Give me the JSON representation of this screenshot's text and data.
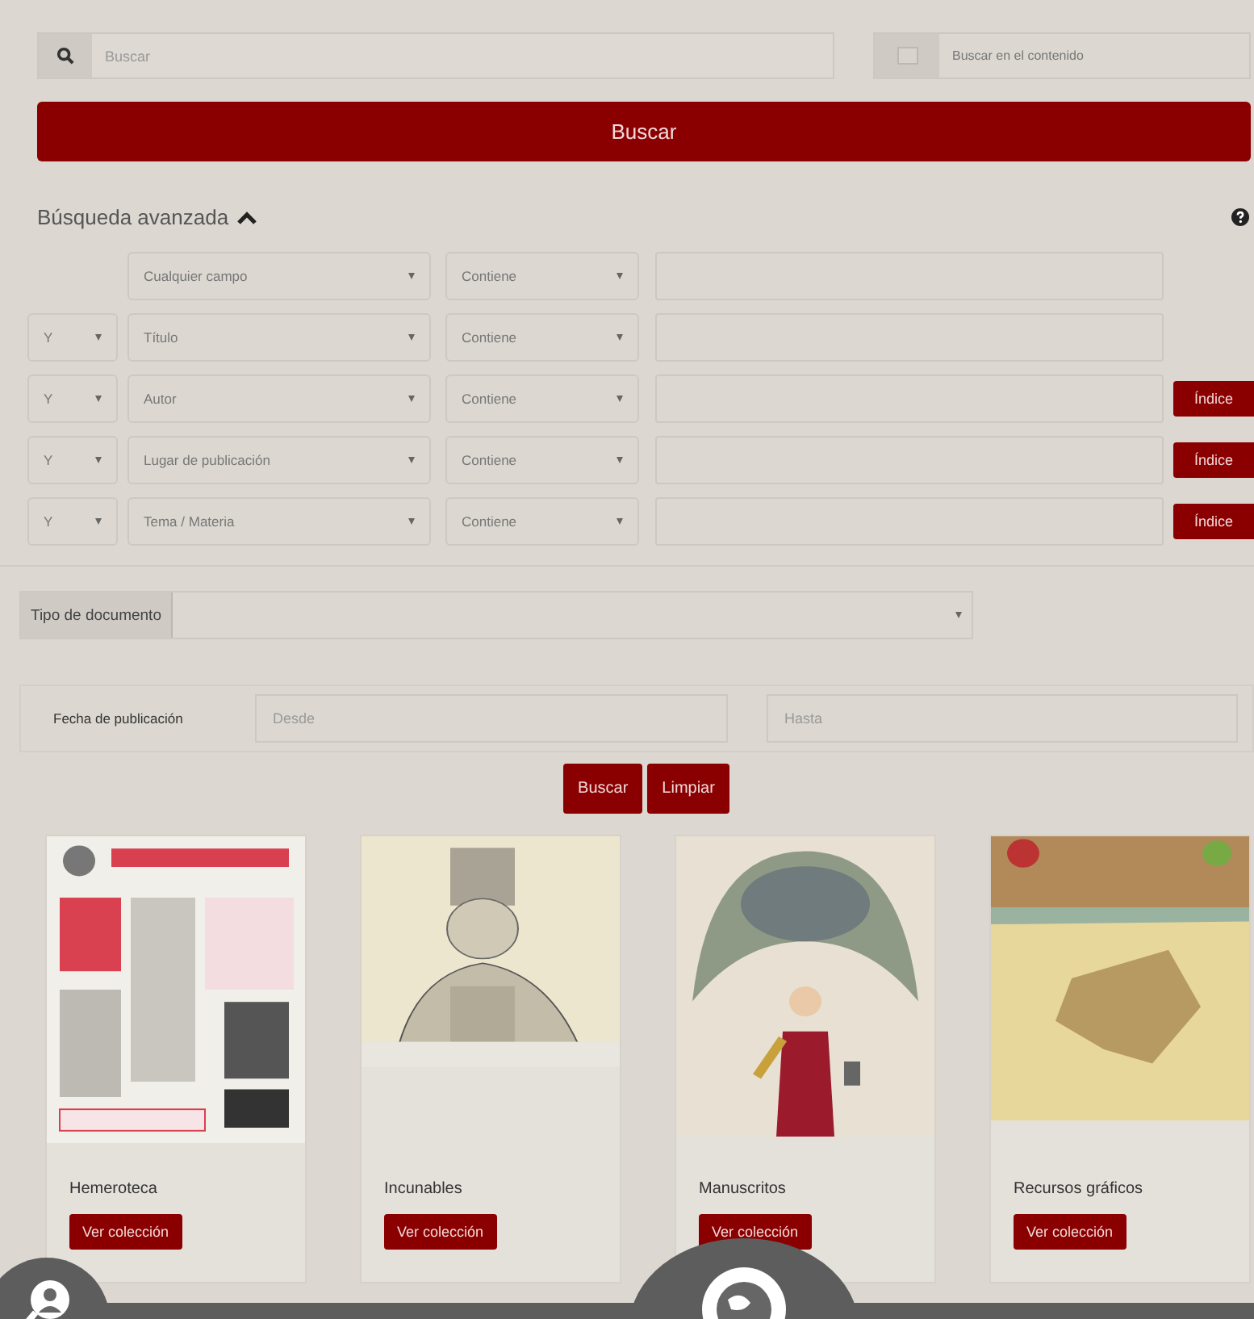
{
  "search": {
    "placeholder": "Buscar",
    "content_label": "Buscar en el contenido",
    "content_checked": false,
    "button": "Buscar"
  },
  "advanced": {
    "title": "Búsqueda avanzada",
    "expanded": true,
    "rows": [
      {
        "field": "Cualquier campo",
        "condition": "Contiene"
      },
      {
        "operator": "Y",
        "field": "Título",
        "condition": "Contiene"
      },
      {
        "operator": "Y",
        "field": "Autor",
        "condition": "Contiene",
        "index_button": "Índice"
      },
      {
        "operator": "Y",
        "field": "Lugar de publicación",
        "condition": "Contiene",
        "index_button": "Índice"
      },
      {
        "operator": "Y",
        "field": "Tema / Materia",
        "condition": "Contiene",
        "index_button": "Índice"
      }
    ],
    "document_type": {
      "label": "Tipo de documento"
    },
    "date": {
      "label": "Fecha de publicación",
      "from_placeholder": "Desde",
      "to_placeholder": "Hasta"
    },
    "actions": [
      "Buscar",
      "Limpiar"
    ]
  },
  "collections": [
    {
      "title": "Hemeroteca",
      "button": "Ver colección"
    },
    {
      "title": "Incunables",
      "button": "Ver colección"
    },
    {
      "title": "Manuscritos",
      "button": "Ver colección"
    },
    {
      "title": "Recursos gráficos",
      "button": "Ver colección"
    }
  ]
}
